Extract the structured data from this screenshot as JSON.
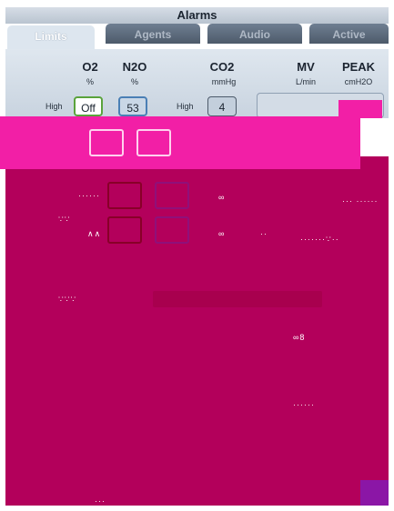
{
  "window": {
    "title": "Alarms"
  },
  "tabs": [
    {
      "label": "Limits",
      "active": true
    },
    {
      "label": "Agents",
      "active": false
    },
    {
      "label": "Audio",
      "active": false
    },
    {
      "label": "Active",
      "active": false
    }
  ],
  "columns": [
    {
      "name": "O2",
      "unit": "%"
    },
    {
      "name": "N2O",
      "unit": "%"
    },
    {
      "name": "CO2",
      "unit": "mmHg"
    },
    {
      "name": "MV",
      "unit": "L/min"
    },
    {
      "name": "PEAK",
      "unit": "cmH2O"
    }
  ],
  "row_high": {
    "label": "High",
    "o2": "Off",
    "n2o": "53",
    "co2_label": "High",
    "co2": "4"
  },
  "colors": {
    "accent": "#b3005b",
    "o2_border": "#5aa33c",
    "n2o_border": "#4a7fb5",
    "tab_bg": "#4d5a6a"
  }
}
